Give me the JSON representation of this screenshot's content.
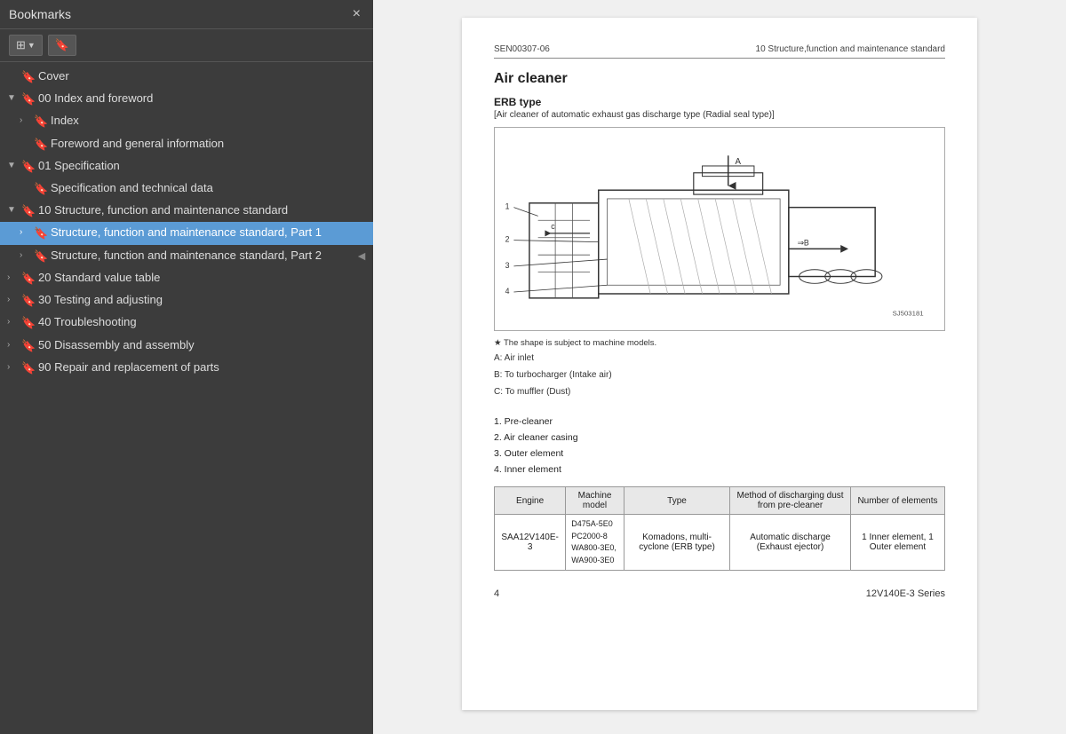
{
  "sidebar": {
    "title": "Bookmarks",
    "close_label": "×",
    "toolbar": {
      "grid_btn": "⊞",
      "bookmark_btn": "🔖"
    },
    "items": [
      {
        "id": "cover",
        "label": "Cover",
        "level": 0,
        "has_arrow": false,
        "arrow_open": false,
        "selected": false
      },
      {
        "id": "00-index-foreword",
        "label": "00 Index and foreword",
        "level": 0,
        "has_arrow": true,
        "arrow_open": true,
        "selected": false
      },
      {
        "id": "index",
        "label": "Index",
        "level": 1,
        "has_arrow": true,
        "arrow_open": false,
        "selected": false
      },
      {
        "id": "foreword",
        "label": "Foreword and general information",
        "level": 1,
        "has_arrow": false,
        "arrow_open": false,
        "selected": false
      },
      {
        "id": "01-spec",
        "label": "01 Specification",
        "level": 0,
        "has_arrow": true,
        "arrow_open": true,
        "selected": false
      },
      {
        "id": "spec-data",
        "label": "Specification and technical data",
        "level": 1,
        "has_arrow": false,
        "arrow_open": false,
        "selected": false
      },
      {
        "id": "10-structure",
        "label": "10 Structure, function and maintenance standard",
        "level": 0,
        "has_arrow": true,
        "arrow_open": true,
        "selected": false
      },
      {
        "id": "struct-part1",
        "label": "Structure, function and maintenance standard, Part 1",
        "level": 1,
        "has_arrow": true,
        "arrow_open": false,
        "selected": true,
        "has_right_indicator": true
      },
      {
        "id": "struct-part2",
        "label": "Structure, function and maintenance standard, Part 2",
        "level": 1,
        "has_arrow": true,
        "arrow_open": false,
        "selected": false
      },
      {
        "id": "20-standard",
        "label": "20 Standard value table",
        "level": 0,
        "has_arrow": true,
        "arrow_open": false,
        "selected": false
      },
      {
        "id": "30-testing",
        "label": "30 Testing and adjusting",
        "level": 0,
        "has_arrow": true,
        "arrow_open": false,
        "selected": false
      },
      {
        "id": "40-troubleshoot",
        "label": "40 Troubleshooting",
        "level": 0,
        "has_arrow": true,
        "arrow_open": false,
        "selected": false
      },
      {
        "id": "50-disassembly",
        "label": "50 Disassembly and assembly",
        "level": 0,
        "has_arrow": true,
        "arrow_open": false,
        "selected": false
      },
      {
        "id": "90-repair",
        "label": "90 Repair and replacement of parts",
        "level": 0,
        "has_arrow": true,
        "arrow_open": false,
        "selected": false
      }
    ]
  },
  "document": {
    "header_left": "SEN00307-06",
    "header_right": "10 Structure,function and maintenance standard",
    "section_title": "Air cleaner",
    "subtitle": "ERB type",
    "subtitle_desc": "[Air cleaner of automatic exhaust gas discharge type (Radial seal type)]",
    "figure_num": "SJ503181",
    "diagram_caption": "★  The shape is subject to machine models.",
    "labels": {
      "A": "A: Air inlet",
      "B": "B: To turbocharger (Intake air)",
      "C": "C: To muffler (Dust)"
    },
    "parts_list": [
      "1. Pre-cleaner",
      "2. Air cleaner casing",
      "3. Outer element",
      "4. Inner element"
    ],
    "table": {
      "headers": [
        "Engine",
        "Machine model",
        "Type",
        "Method of discharging dust from pre-cleaner",
        "Number of elements"
      ],
      "rows": [
        [
          "SAA12V140E-3",
          "D475A-5E0\nPC2000-8\nWA800-3E0,\nWA900-3E0",
          "Komadons, multi-cyclone (ERB type)",
          "Automatic discharge (Exhaust ejector)",
          "1 Inner element, 1 Outer element"
        ]
      ]
    },
    "footer_page": "4",
    "footer_series": "12V140E-3 Series"
  }
}
